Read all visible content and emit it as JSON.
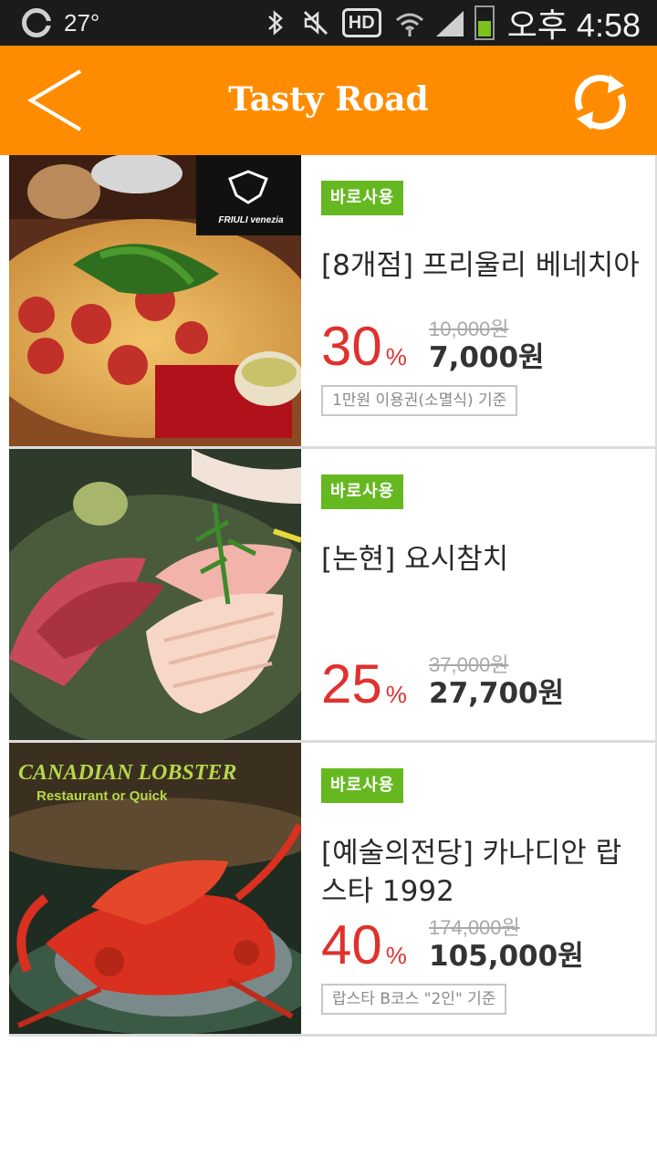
{
  "status_bar": {
    "temperature": "27°",
    "hd_label": "HD",
    "time": "오후 4:58",
    "battery_level": 0.5
  },
  "header": {
    "title": "Tasty Road",
    "color": "#ff8c00"
  },
  "deals": [
    {
      "badge": "바로사용",
      "name": "[8개점] 프리울리 베네치아",
      "discount": "30",
      "discount_unit": "%",
      "original_price": "10,000원",
      "price": "7,000원",
      "note": "1만원 이용권(소멸식) 기준",
      "image_logo_top": "FRIULI venezia",
      "image_logo_sub": ""
    },
    {
      "badge": "바로사용",
      "name": "[논현] 요시참치",
      "discount": "25",
      "discount_unit": "%",
      "original_price": "37,000원",
      "price": "27,700원",
      "note": ""
    },
    {
      "badge": "바로사용",
      "name": "[예술의전당] 카나디안 랍스타 1992",
      "discount": "40",
      "discount_unit": "%",
      "original_price": "174,000원",
      "price": "105,000원",
      "note": "랍스타 B코스 \"2인\" 기준",
      "image_logo_top": "CANADIAN LOBSTER",
      "image_logo_sub": "Restaurant or Quick"
    }
  ],
  "colors": {
    "badge": "#66b821",
    "discount": "#e0312e"
  }
}
